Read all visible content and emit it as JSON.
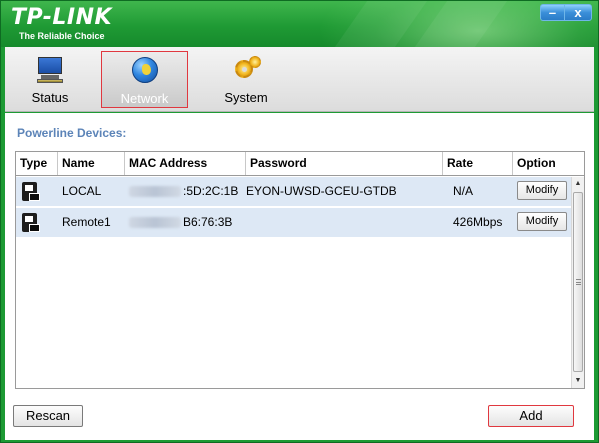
{
  "app": {
    "logo_title": "TP-LINK",
    "logo_tagline": "The Reliable Choice",
    "window_buttons": {
      "minimize": "–",
      "close": "x"
    }
  },
  "tabs": [
    {
      "label": "Status",
      "icon": "monitor-icon",
      "active": false
    },
    {
      "label": "Network",
      "icon": "globe-icon",
      "active": true
    },
    {
      "label": "System",
      "icon": "gears-icon",
      "active": false
    }
  ],
  "section": {
    "title": "Powerline Devices:"
  },
  "table": {
    "columns": [
      "Type",
      "Name",
      "MAC Address",
      "Password",
      "Rate",
      "Option"
    ],
    "rows": [
      {
        "type_icon": "powerline-device-icon",
        "name": "LOCAL",
        "mac_visible": ":5D:2C:1B",
        "password": "EYON-UWSD-GCEU-GTDB",
        "rate": "N/A",
        "option": "Modify"
      },
      {
        "type_icon": "powerline-device-icon",
        "name": "Remote1",
        "mac_visible": "B6:76:3B",
        "password": "",
        "rate": "426Mbps",
        "option": "Modify"
      }
    ]
  },
  "buttons": {
    "rescan": "Rescan",
    "add": "Add"
  },
  "colors": {
    "brand_green": "#1d9a34",
    "section_title_blue": "#5c84b8",
    "row_highlight": "#dde8f5",
    "focus_red": "#e0383f"
  }
}
